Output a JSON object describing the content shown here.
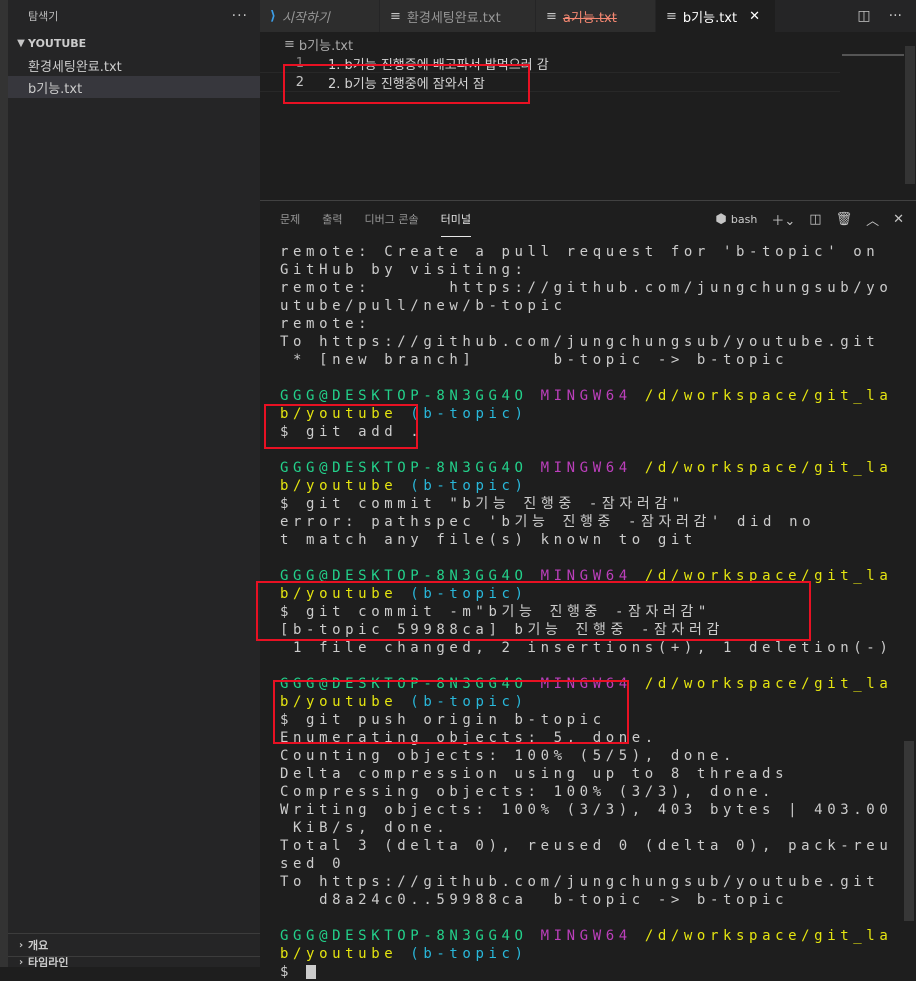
{
  "sidebar": {
    "title": "탐색기",
    "more": "···",
    "workspace": "YOUTUBE",
    "files": [
      "환경세팅완료.txt",
      "b기능.txt"
    ],
    "outline": "개요",
    "timeline": "타임라인"
  },
  "tabs": [
    {
      "label": "시작하기",
      "kind": "preview"
    },
    {
      "label": "환경세팅완료.txt",
      "kind": "normal"
    },
    {
      "label": "a기능.txt",
      "kind": "deleted"
    },
    {
      "label": "b기능.txt",
      "kind": "active"
    }
  ],
  "editor": {
    "breadcrumb": "b기능.txt",
    "lines": [
      {
        "num": "1",
        "text": "1. b기능 진행중에 배고파서 밥먹으러 감"
      },
      {
        "num": "2",
        "text": "2. b기능 진행중에 잠와서 잠"
      }
    ]
  },
  "panel": {
    "tabs": [
      "문제",
      "출력",
      "디버그 콘솔",
      "터미널"
    ],
    "shell": "bash"
  },
  "terminal": [
    [
      {
        "t": "remote: Create a pull request for 'b-topic' on"
      }
    ],
    [
      {
        "t": "GitHub by visiting:"
      }
    ],
    [
      {
        "t": "remote:      https://github.com/jungchungsub/yo"
      }
    ],
    [
      {
        "t": "utube/pull/new/b-topic"
      }
    ],
    [
      {
        "t": "remote:"
      }
    ],
    [
      {
        "t": "To https://github.com/jungchungsub/youtube.git"
      }
    ],
    [
      {
        "t": " * [new branch]      b-topic -> b-topic"
      }
    ],
    [
      {
        "t": ""
      }
    ],
    [
      {
        "t": "GGG@DESKTOP-8N3GG4O",
        "c": "g"
      },
      {
        "t": " "
      },
      {
        "t": "MINGW64",
        "c": "m"
      },
      {
        "t": " "
      },
      {
        "t": "/d/workspace/git_la",
        "c": "y"
      }
    ],
    [
      {
        "t": "b/youtube",
        "c": "y"
      },
      {
        "t": " "
      },
      {
        "t": "(b-topic)",
        "c": "c"
      }
    ],
    [
      {
        "t": "$ git add ."
      }
    ],
    [
      {
        "t": ""
      }
    ],
    [
      {
        "t": "GGG@DESKTOP-8N3GG4O",
        "c": "g"
      },
      {
        "t": " "
      },
      {
        "t": "MINGW64",
        "c": "m"
      },
      {
        "t": " "
      },
      {
        "t": "/d/workspace/git_la",
        "c": "y"
      }
    ],
    [
      {
        "t": "b/youtube",
        "c": "y"
      },
      {
        "t": " "
      },
      {
        "t": "(b-topic)",
        "c": "c"
      }
    ],
    [
      {
        "t": "$ git commit \"b기능 진행중 -잠자러감\""
      }
    ],
    [
      {
        "t": "error: pathspec 'b기능 진행중 -잠자러감' did no"
      }
    ],
    [
      {
        "t": "t match any file(s) known to git"
      }
    ],
    [
      {
        "t": ""
      }
    ],
    [
      {
        "t": "GGG@DESKTOP-8N3GG4O",
        "c": "g"
      },
      {
        "t": " "
      },
      {
        "t": "MINGW64",
        "c": "m"
      },
      {
        "t": " "
      },
      {
        "t": "/d/workspace/git_la",
        "c": "y"
      }
    ],
    [
      {
        "t": "b/youtube",
        "c": "y"
      },
      {
        "t": " "
      },
      {
        "t": "(b-topic)",
        "c": "c"
      }
    ],
    [
      {
        "t": "$ git commit -m\"b기능 진행중 -잠자러감\""
      }
    ],
    [
      {
        "t": "[b-topic 59988ca] b기능 진행중 -잠자러감"
      }
    ],
    [
      {
        "t": " 1 file changed, 2 insertions(+), 1 deletion(-)"
      }
    ],
    [
      {
        "t": ""
      }
    ],
    [
      {
        "t": "GGG@DESKTOP-8N3GG4O",
        "c": "g"
      },
      {
        "t": " "
      },
      {
        "t": "MINGW64",
        "c": "m"
      },
      {
        "t": " "
      },
      {
        "t": "/d/workspace/git_la",
        "c": "y"
      }
    ],
    [
      {
        "t": "b/youtube",
        "c": "y"
      },
      {
        "t": " "
      },
      {
        "t": "(b-topic)",
        "c": "c"
      }
    ],
    [
      {
        "t": "$ git push origin b-topic"
      }
    ],
    [
      {
        "t": "Enumerating objects: 5, done."
      }
    ],
    [
      {
        "t": "Counting objects: 100% (5/5), done."
      }
    ],
    [
      {
        "t": "Delta compression using up to 8 threads"
      }
    ],
    [
      {
        "t": "Compressing objects: 100% (3/3), done."
      }
    ],
    [
      {
        "t": "Writing objects: 100% (3/3), 403 bytes | 403.00"
      }
    ],
    [
      {
        "t": " KiB/s, done."
      }
    ],
    [
      {
        "t": "Total 3 (delta 0), reused 0 (delta 0), pack-reu"
      }
    ],
    [
      {
        "t": "sed 0"
      }
    ],
    [
      {
        "t": "To https://github.com/jungchungsub/youtube.git"
      }
    ],
    [
      {
        "t": "   d8a24c0..59988ca  b-topic -> b-topic"
      }
    ],
    [
      {
        "t": ""
      }
    ],
    [
      {
        "t": "GGG@DESKTOP-8N3GG4O",
        "c": "g"
      },
      {
        "t": " "
      },
      {
        "t": "MINGW64",
        "c": "m"
      },
      {
        "t": " "
      },
      {
        "t": "/d/workspace/git_la",
        "c": "y"
      }
    ],
    [
      {
        "t": "b/youtube",
        "c": "y"
      },
      {
        "t": " "
      },
      {
        "t": "(b-topic)",
        "c": "c"
      }
    ],
    [
      {
        "t": "$ "
      },
      {
        "t": "",
        "c": "cursor"
      }
    ]
  ]
}
